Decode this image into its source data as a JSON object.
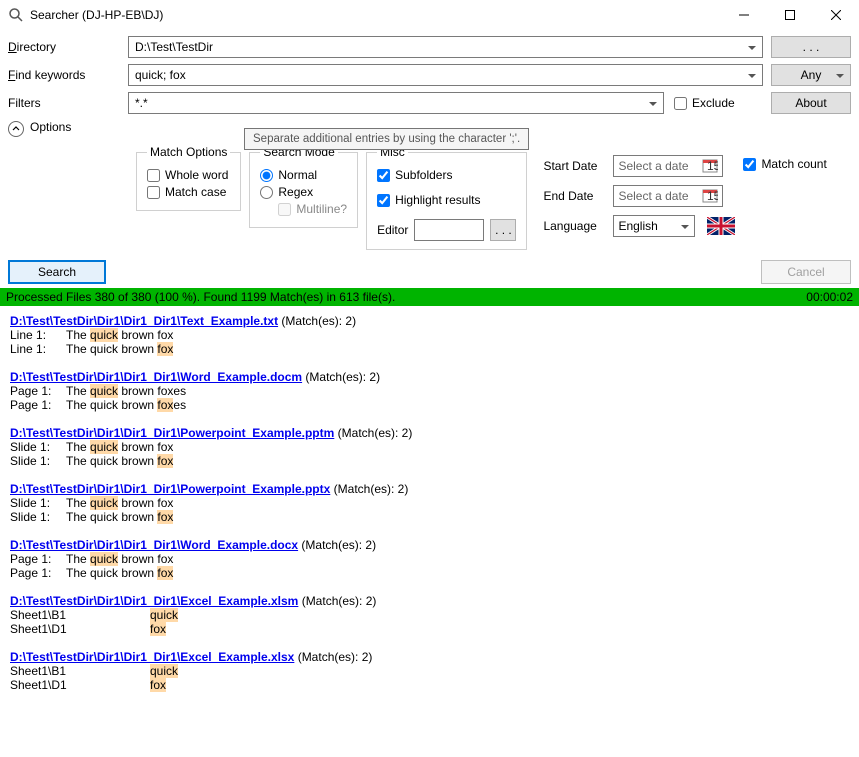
{
  "window": {
    "title": "Searcher (DJ-HP-EB\\DJ)"
  },
  "labels": {
    "directory": "Directory",
    "directory_u": "D",
    "find": "Find keywords",
    "find_u": "F",
    "filters": "Filters",
    "options": "Options",
    "exclude": "Exclude",
    "exclude_u": "E",
    "any": "Any",
    "about": "About",
    "browse": ". . .",
    "search": "Search",
    "cancel": "Cancel"
  },
  "inputs": {
    "directory": "D:\\Test\\TestDir",
    "keywords": "quick; fox",
    "filters": "*.*"
  },
  "tooltip": "Separate additional entries by using the character ';'.",
  "groups": {
    "match_options": {
      "legend": "Match Options",
      "whole_word": "Whole word",
      "whole_word_u": "w",
      "match_case": "Match case",
      "match_case_u": "c"
    },
    "search_mode": {
      "legend": "Search Mode",
      "normal": "Normal",
      "normal_u": "N",
      "regex": "Regex",
      "regex_u": "R",
      "multiline": "Multiline?",
      "multiline_u": "M"
    },
    "misc": {
      "legend": "Misc",
      "subfolders": "Subfolders",
      "subfolders_u": "S",
      "highlight": "Highlight results",
      "highlight_u": "H",
      "editor": "Editor",
      "editor_btn": ". . ."
    },
    "dates": {
      "start": "Start Date",
      "end": "End Date",
      "language": "Language",
      "select_date": "Select a date",
      "lang_value": "English"
    },
    "match_count": "Match count"
  },
  "status": {
    "text": "Processed Files 380 of 380 (100 %).   Found 1199 Match(es) in 613 file(s).",
    "time": "00:00:02"
  },
  "results": [
    {
      "path": "D:\\Test\\TestDir\\Dir1\\Dir1_Dir1\\Text_Example.txt",
      "matches": "(Match(es): 2)",
      "lines": [
        {
          "loc": "Line 1:",
          "pre": "The ",
          "hl": "quick",
          "post": " brown fox"
        },
        {
          "loc": "Line 1:",
          "pre": "The quick brown ",
          "hl": "fox",
          "post": ""
        }
      ]
    },
    {
      "path": "D:\\Test\\TestDir\\Dir1\\Dir1_Dir1\\Word_Example.docm",
      "matches": "(Match(es): 2)",
      "lines": [
        {
          "loc": "Page 1:",
          "pre": "The ",
          "hl": "quick",
          "post": " brown foxes"
        },
        {
          "loc": "Page 1:",
          "pre": "The quick brown ",
          "hl": "fox",
          "post": "es"
        }
      ]
    },
    {
      "path": "D:\\Test\\TestDir\\Dir1\\Dir1_Dir1\\Powerpoint_Example.pptm",
      "matches": "(Match(es): 2)",
      "lines": [
        {
          "loc": "Slide 1:",
          "pre": "The ",
          "hl": "quick",
          "post": " brown fox"
        },
        {
          "loc": "Slide 1:",
          "pre": "The quick brown ",
          "hl": "fox",
          "post": ""
        }
      ]
    },
    {
      "path": "D:\\Test\\TestDir\\Dir1\\Dir1_Dir1\\Powerpoint_Example.pptx",
      "matches": "(Match(es): 2)",
      "lines": [
        {
          "loc": "Slide 1:",
          "pre": "The ",
          "hl": "quick",
          "post": " brown fox"
        },
        {
          "loc": "Slide 1:",
          "pre": "The quick brown ",
          "hl": "fox",
          "post": ""
        }
      ]
    },
    {
      "path": "D:\\Test\\TestDir\\Dir1\\Dir1_Dir1\\Word_Example.docx",
      "matches": "(Match(es): 2)",
      "lines": [
        {
          "loc": "Page 1:",
          "pre": "The ",
          "hl": "quick",
          "post": " brown fox"
        },
        {
          "loc": "Page 1:",
          "pre": "The quick brown ",
          "hl": "fox",
          "post": ""
        }
      ]
    },
    {
      "path": "D:\\Test\\TestDir\\Dir1\\Dir1_Dir1\\Excel_Example.xlsm",
      "matches": "(Match(es): 2)",
      "lines": [
        {
          "loc": "Sheet1\\B1",
          "pre": "",
          "hl": "quick",
          "post": ""
        },
        {
          "loc": "Sheet1\\D1",
          "pre": "",
          "hl": "fox",
          "post": ""
        }
      ]
    },
    {
      "path": "D:\\Test\\TestDir\\Dir1\\Dir1_Dir1\\Excel_Example.xlsx",
      "matches": "(Match(es): 2)",
      "lines": [
        {
          "loc": "Sheet1\\B1",
          "pre": "",
          "hl": "quick",
          "post": ""
        },
        {
          "loc": "Sheet1\\D1",
          "pre": "",
          "hl": "fox",
          "post": ""
        }
      ]
    }
  ]
}
